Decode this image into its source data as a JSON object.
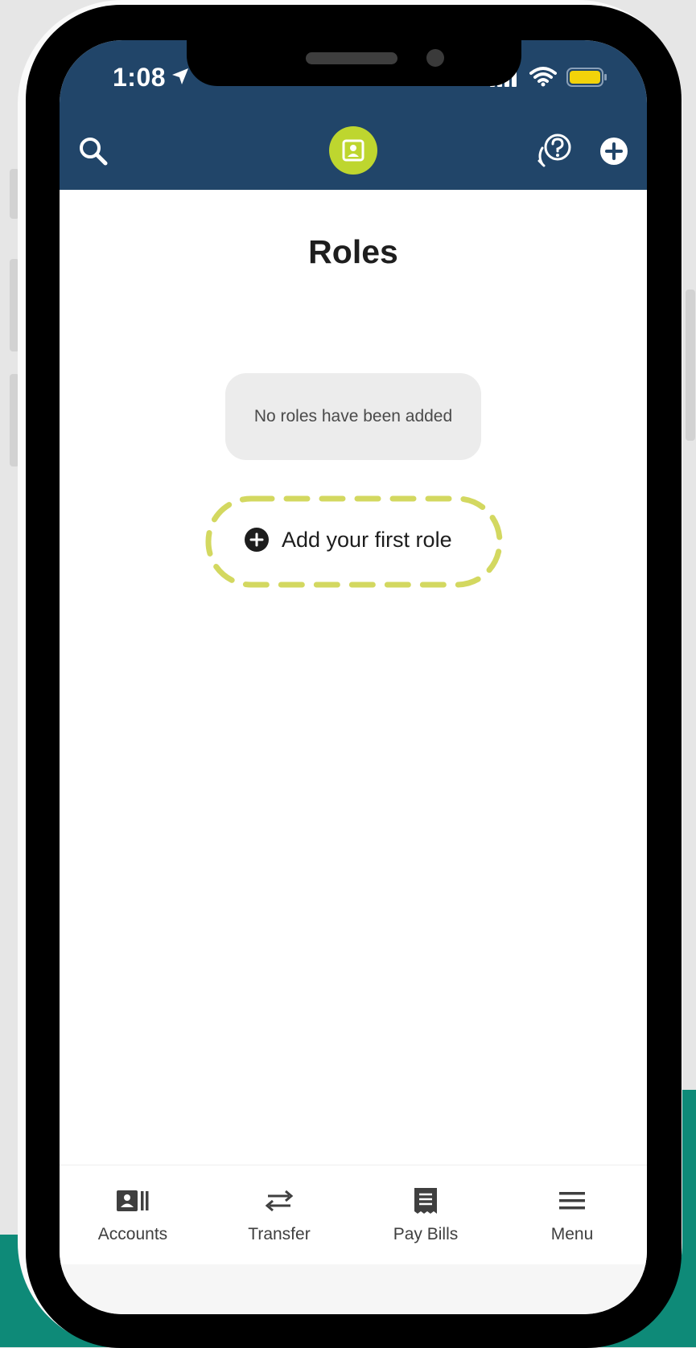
{
  "status_bar": {
    "time": "1:08"
  },
  "header": {
    "search_icon": "search-icon",
    "center_icon": "contact-card-icon",
    "help_icon": "help-chat-icon",
    "add_icon": "plus-circle-icon"
  },
  "page": {
    "title": "Roles",
    "empty_message": "No roles have been added",
    "add_button_label": "Add your first role"
  },
  "colors": {
    "header_bg": "#214569",
    "accent_green": "#bed62f",
    "highlight_dash": "#d3d860",
    "background_teal": "#0e8a78"
  },
  "bottom_nav": {
    "items": [
      {
        "label": "Accounts",
        "icon": "accounts-icon"
      },
      {
        "label": "Transfer",
        "icon": "transfer-icon"
      },
      {
        "label": "Pay Bills",
        "icon": "receipt-icon"
      },
      {
        "label": "Menu",
        "icon": "menu-icon"
      }
    ]
  }
}
